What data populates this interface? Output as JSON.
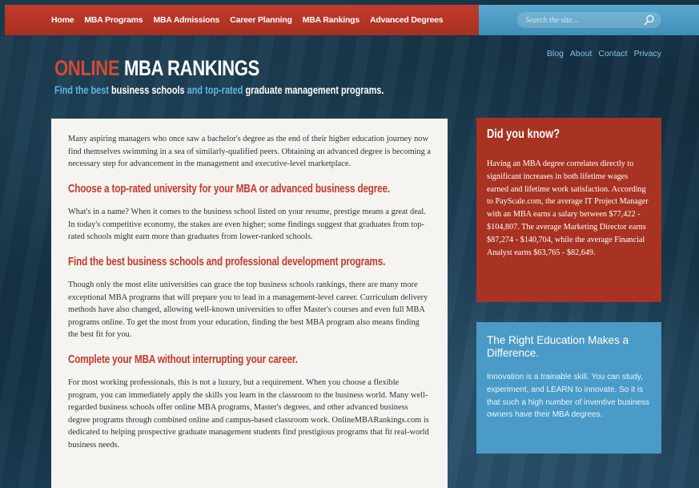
{
  "nav": {
    "items": [
      "Home",
      "MBA Programs",
      "MBA Admissions",
      "Career Planning",
      "MBA Rankings",
      "Advanced Degrees"
    ]
  },
  "search": {
    "placeholder": "Search the site..."
  },
  "utility_links": [
    "Blog",
    "About",
    "Contact",
    "Privacy"
  ],
  "brand": {
    "accent": "ONLINE",
    "rest": "MBA RANKINGS"
  },
  "tagline": {
    "part1": "Find the best",
    "part2": "business schools",
    "part3": "and",
    "part4": "top-rated",
    "part5": "graduate management programs."
  },
  "article": {
    "intro": "Many aspiring managers who once saw a bachelor's degree as the end of their higher education journey now find themselves swimming in a sea of similarly-qualified peers. Obtaining an advanced degree is becoming a necessary step for advancement in the management and executive-level marketplace.",
    "h1": "Choose a top-rated university for your MBA or advanced business degree.",
    "p1": "What's in a name? When it comes to the business school listed on your resume, prestige means a great deal. In today's competitive economy, the stakes are even higher; some findings suggest that graduates from top-rated schools might earn more than graduates from lower-ranked schools.",
    "h2": "Find the best business schools and professional development programs.",
    "p2": "Though only the most elite universities can grace the top business schools rankings, there are many more exceptional MBA programs that will prepare you to lead in a management-level career. Curriculum delivery methods have also changed, allowing well-known universities to offer Master's courses and even full MBA programs online. To get the most from your education, finding the best MBA program also means finding the best fit for you.",
    "h3": "Complete your MBA without interrupting your career.",
    "p3": "For most working professionals, this is not a luxury, but a requirement. When you choose a flexible program, you can immediately apply the skills you learn in the classroom to the business world. Many well-regarded business schools offer online MBA programs, Master's degrees, and other advanced business degree programs through combined online and campus-based classroom work. OnlineMBARankings.com is dedicated to helping prospective graduate management students find prestigious programs that fit real-world business needs."
  },
  "did_you_know": {
    "title": "Did you know?",
    "body": "Having an MBA degree correlates directly to significant increases in both lifetime wages earned and lifetime work satisfaction. According to PayScale.com, the average IT Project Manager with an MBA earns a salary between $77,422 - $104,807. The average Marketing Director earns $87,274 - $140,704, while the average Financial Analyst earns $63,765 - $82,649."
  },
  "right_education": {
    "title": "The Right Education Makes a Difference.",
    "body": "Innovation is a trainable skill. You can study, experiment, and LEARN to innovate. So it is that such a high number of inventive business owners have their MBA degrees."
  },
  "colors": {
    "nav_red": "#c23b2c",
    "search_blue": "#4b9bc9",
    "link_blue": "#7fc3ec",
    "heading_red": "#c23b2c",
    "sidebar_red": "#a83322",
    "sidebar_blue": "#4b9bc9"
  },
  "icons": {
    "search": "magnifier-icon"
  }
}
